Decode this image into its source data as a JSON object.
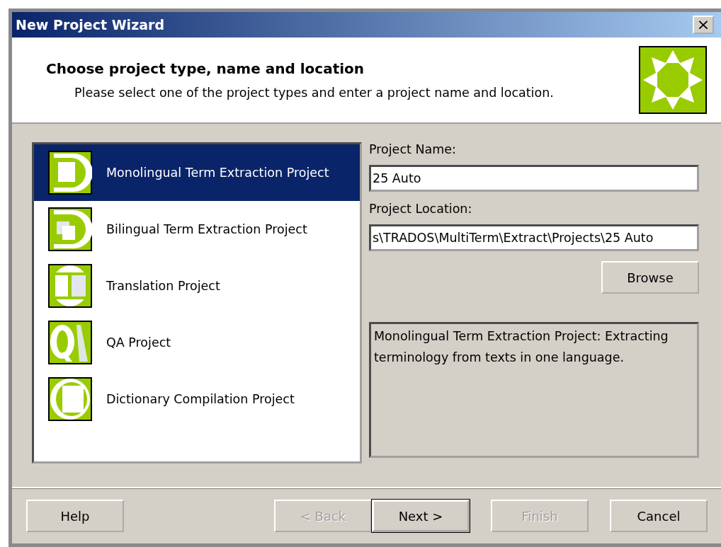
{
  "window": {
    "title": "New Project Wizard",
    "close": "×"
  },
  "header": {
    "title": "Choose project type, name and location",
    "subtitle": "Please select one of the project types and enter a project name and location."
  },
  "project_types": [
    {
      "label": "Monolingual Term Extraction Project",
      "kind": "monolingual",
      "selected": true
    },
    {
      "label": "Bilingual Term Extraction Project",
      "kind": "bilingual",
      "selected": false
    },
    {
      "label": "Translation Project",
      "kind": "translation",
      "selected": false
    },
    {
      "label": "QA Project",
      "kind": "qa",
      "selected": false
    },
    {
      "label": "Dictionary Compilation Project",
      "kind": "dictionary",
      "selected": false
    }
  ],
  "project_name": {
    "label": "Project Name:",
    "value": "25 Auto"
  },
  "project_location": {
    "label": "Project Location:",
    "value": "s\\TRADOS\\MultiTerm\\Extract\\Projects\\25 Auto"
  },
  "browse_button": "Browse",
  "description": "Monolingual Term Extraction Project: Extracting terminology from texts in one language.",
  "buttons": [
    {
      "label": "Help",
      "disabled": false,
      "default": false
    },
    {
      "label": "< Back",
      "disabled": true,
      "default": false
    },
    {
      "label": "Next >",
      "disabled": false,
      "default": true
    },
    {
      "label": "Finish",
      "disabled": true,
      "default": false
    },
    {
      "label": "Cancel",
      "disabled": false,
      "default": false
    }
  ]
}
